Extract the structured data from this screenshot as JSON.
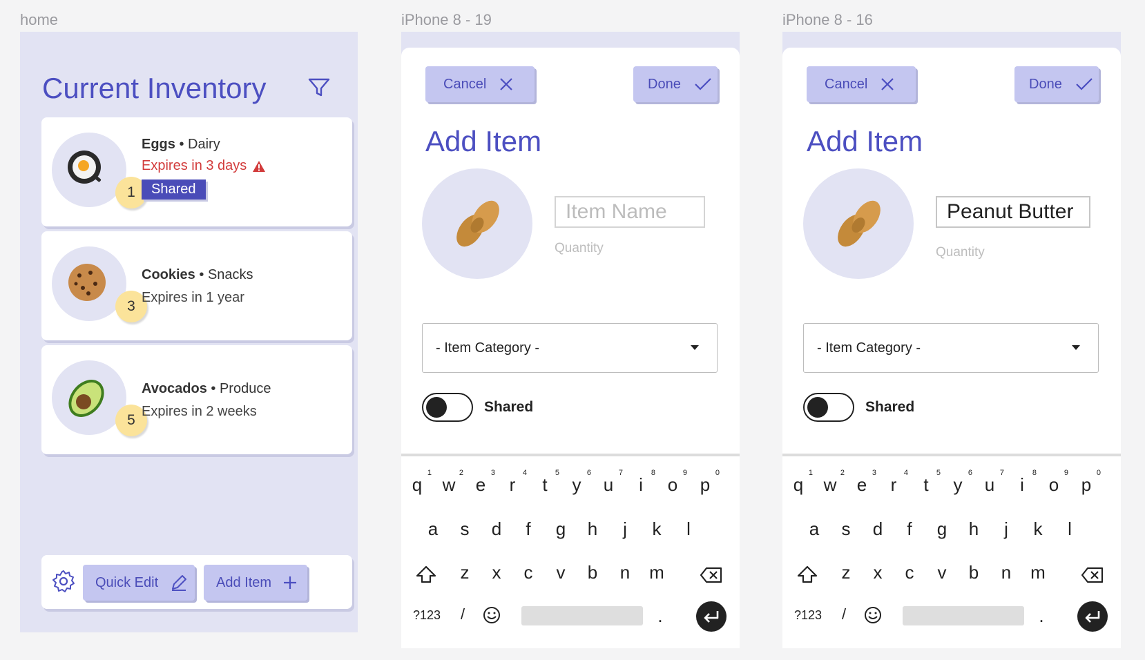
{
  "frames": {
    "home_label": "home",
    "p19_label": "iPhone 8 - 19",
    "p16_label": "iPhone 8 - 16"
  },
  "home": {
    "title": "Current Inventory",
    "items": [
      {
        "name": "Eggs",
        "category": "Dairy",
        "expiry": "Expires in 3 days",
        "qty": "1",
        "shared": "Shared",
        "icon": "fried-egg-icon"
      },
      {
        "name": "Cookies",
        "category": "Snacks",
        "expiry": "Expires in 1 year",
        "qty": "3",
        "icon": "cookie-icon"
      },
      {
        "name": "Avocados",
        "category": "Produce",
        "expiry": "Expires in 2 weeks",
        "qty": "5",
        "icon": "avocado-icon"
      }
    ],
    "toolbar": {
      "quick_edit": "Quick Edit",
      "add_item": "Add Item"
    },
    "colors": {
      "accent": "#4c4fc1",
      "warning": "#d23b3b",
      "badge": "#fbe39a"
    }
  },
  "add_screen_19": {
    "cancel": "Cancel",
    "done": "Done",
    "title": "Add Item",
    "name_placeholder": "Item Name",
    "quantity_label": "Quantity",
    "category": "- Item Category -",
    "shared_label": "Shared",
    "photo_icon": "peanut-icon"
  },
  "add_screen_16": {
    "cancel": "Cancel",
    "done": "Done",
    "title": "Add Item",
    "name_value": "Peanut Butter",
    "quantity_label": "Quantity",
    "category": "- Item Category -",
    "shared_label": "Shared",
    "photo_icon": "peanut-icon"
  },
  "keyboard": {
    "row1": [
      "q",
      "w",
      "e",
      "r",
      "t",
      "y",
      "u",
      "i",
      "o",
      "p"
    ],
    "row1_digits": [
      "1",
      "2",
      "3",
      "4",
      "5",
      "6",
      "7",
      "8",
      "9",
      "0"
    ],
    "row2": [
      "a",
      "s",
      "d",
      "f",
      "g",
      "h",
      "j",
      "k",
      "l"
    ],
    "row3": [
      "z",
      "x",
      "c",
      "v",
      "b",
      "n",
      "m"
    ],
    "symbols_key": "?123",
    "slash_key": "/",
    "period_key": "."
  }
}
